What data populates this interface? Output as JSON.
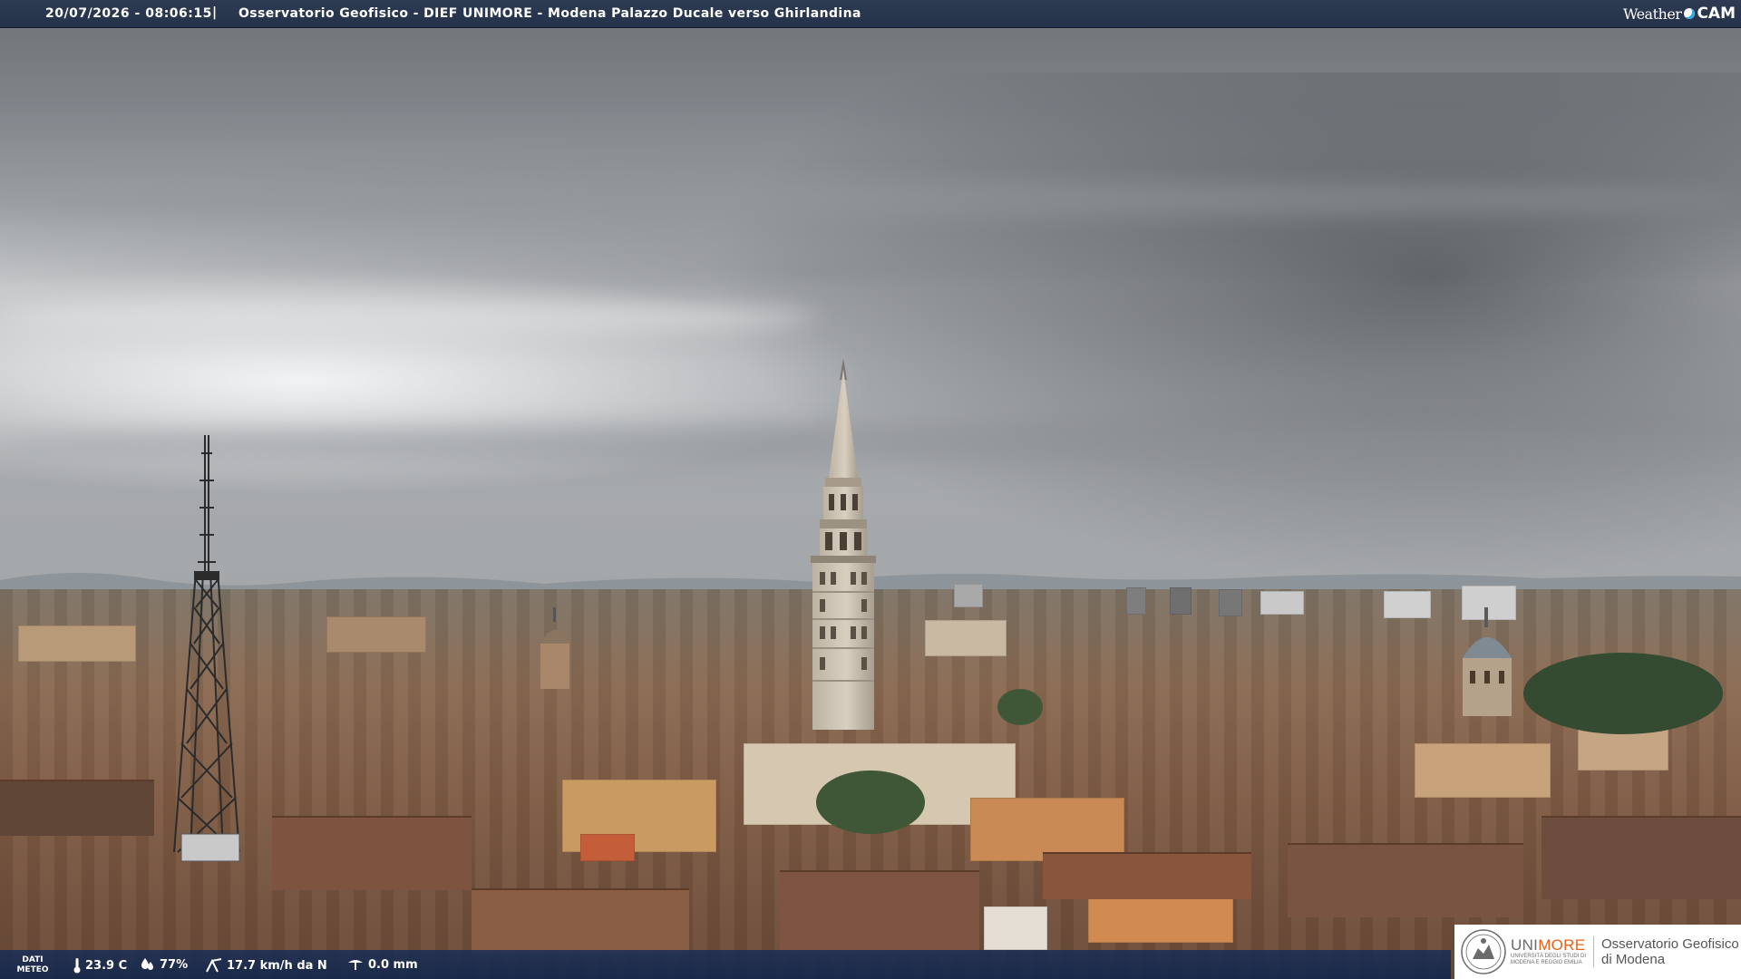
{
  "topbar": {
    "datetime": "20/07/2026 - 08:06:15",
    "separator": "|",
    "title": "Osservatorio Geofisico - DIEF UNIMORE - Modena Palazzo Ducale verso Ghirlandina",
    "brand_weather": "Weather",
    "brand_cam": "CAM"
  },
  "meteo": {
    "label_line1": "DATI",
    "label_line2": "METEO",
    "temperature": "23.9 C",
    "humidity": "77%",
    "wind": "17.7 km/h da N",
    "rain": "0.0 mm",
    "icons": [
      "thermometer-icon",
      "humidity-drop-icon",
      "wind-icon",
      "rain-gauge-icon"
    ]
  },
  "logo": {
    "uni_part1": "UNI",
    "uni_part2": "MORE",
    "uni_sub_line1": "UNIVERSITÀ DEGLI STUDI DI",
    "uni_sub_line2": "MODENA E REGGIO EMILIA",
    "obs_line1": "Osservatorio Geofisico",
    "obs_line2": "di Modena",
    "colors": {
      "uni_gray": "#6b6b6b",
      "uni_orange": "#e2631c"
    }
  }
}
